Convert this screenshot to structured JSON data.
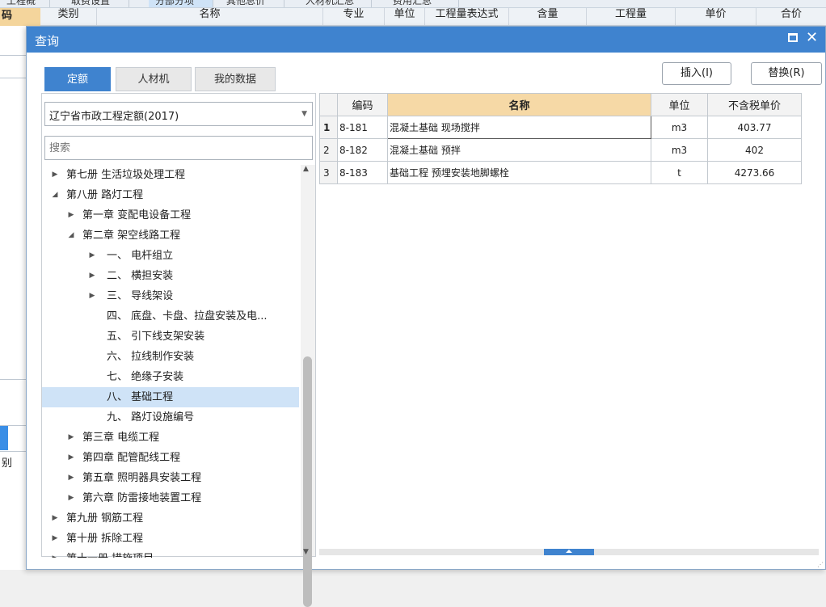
{
  "background": {
    "top_tabs": [
      "工程概况",
      "取费设置",
      "分部分项",
      "其他总价",
      "人材机汇总",
      "费用汇总"
    ],
    "header": {
      "code": "码",
      "columns": [
        "类别",
        "名称",
        "专业",
        "单位",
        "工程量表达式",
        "含量",
        "工程量",
        "单价",
        "合价"
      ]
    },
    "left_label": "别"
  },
  "dialog": {
    "title": "查询",
    "tabs": [
      {
        "label": "定额",
        "active": true
      },
      {
        "label": "人材机",
        "active": false
      },
      {
        "label": "我的数据",
        "active": false
      }
    ],
    "insert_label": "插入(I)",
    "replace_label": "替换(R)",
    "library": {
      "selected": "辽宁省市政工程定额(2017)"
    },
    "search": {
      "placeholder": "搜索"
    },
    "tree": [
      {
        "label": "第七册 生活垃圾处理工程",
        "level": 0,
        "toggle": "collapsed"
      },
      {
        "label": "第八册 路灯工程",
        "level": 0,
        "toggle": "expanded"
      },
      {
        "label": "第一章 变配电设备工程",
        "level": 1,
        "toggle": "collapsed"
      },
      {
        "label": "第二章 架空线路工程",
        "level": 1,
        "toggle": "expanded"
      },
      {
        "label": "一、 电杆组立",
        "level": 2,
        "toggle": "collapsed"
      },
      {
        "label": "二、 横担安装",
        "level": 2,
        "toggle": "collapsed"
      },
      {
        "label": "三、 导线架设",
        "level": 2,
        "toggle": "collapsed"
      },
      {
        "label": "四、 底盘、卡盘、拉盘安装及电...",
        "level": 2,
        "toggle": "none"
      },
      {
        "label": "五、 引下线支架安装",
        "level": 2,
        "toggle": "none"
      },
      {
        "label": "六、 拉线制作安装",
        "level": 2,
        "toggle": "none"
      },
      {
        "label": "七、 绝缘子安装",
        "level": 2,
        "toggle": "none"
      },
      {
        "label": "八、 基础工程",
        "level": 2,
        "toggle": "none",
        "selected": true
      },
      {
        "label": "九、 路灯设施编号",
        "level": 2,
        "toggle": "none"
      },
      {
        "label": "第三章 电缆工程",
        "level": 1,
        "toggle": "collapsed"
      },
      {
        "label": "第四章 配管配线工程",
        "level": 1,
        "toggle": "collapsed"
      },
      {
        "label": "第五章 照明器具安装工程",
        "level": 1,
        "toggle": "collapsed"
      },
      {
        "label": "第六章 防雷接地装置工程",
        "level": 1,
        "toggle": "collapsed"
      },
      {
        "label": "第九册 钢筋工程",
        "level": 0,
        "toggle": "collapsed"
      },
      {
        "label": "第十册 拆除工程",
        "level": 0,
        "toggle": "collapsed"
      },
      {
        "label": "第十一册 措施项目",
        "level": 0,
        "toggle": "collapsed"
      }
    ],
    "table": {
      "headers": [
        "编码",
        "名称",
        "单位",
        "不含税单价"
      ],
      "rows": [
        {
          "no": "1",
          "code": "8-181",
          "name": "混凝土基础 现场搅拌",
          "unit": "m3",
          "price": "403.77"
        },
        {
          "no": "2",
          "code": "8-182",
          "name": "混凝土基础 预拌",
          "unit": "m3",
          "price": "402"
        },
        {
          "no": "3",
          "code": "8-183",
          "name": "基础工程 预埋安装地脚螺栓",
          "unit": "t",
          "price": "4273.66"
        }
      ]
    }
  },
  "colors": {
    "accent": "#3f83cf",
    "header_highlight": "#f6d9a6",
    "tree_selected": "#cfe3f7"
  },
  "icons": {
    "maximize": "maximize-icon",
    "close": "close-icon",
    "dropdown": "chevron-down-icon"
  }
}
